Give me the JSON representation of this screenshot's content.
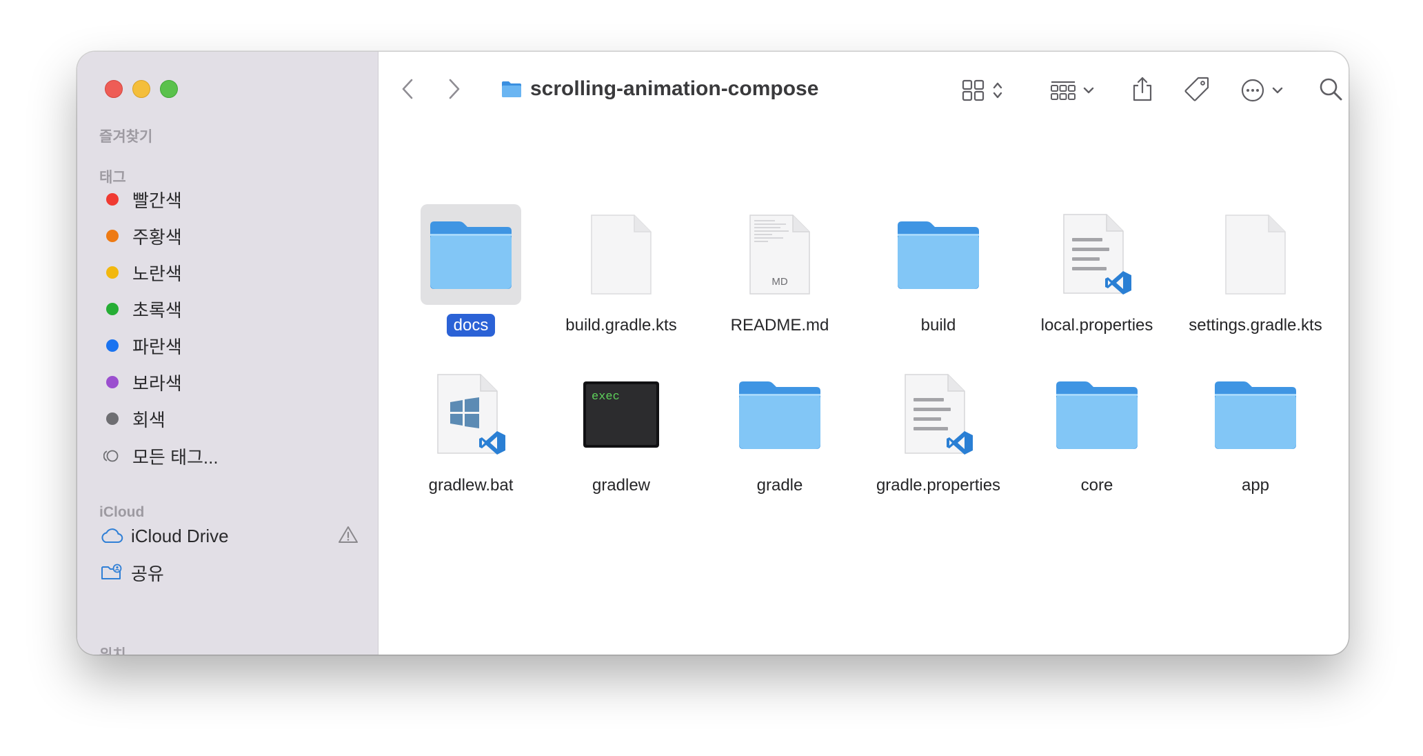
{
  "window": {
    "title": "scrolling-animation-compose"
  },
  "sidebar": {
    "favorites_label": "즐겨찾기",
    "tags_label": "태그",
    "tags": [
      {
        "label": "빨간색",
        "color": "#f03a32"
      },
      {
        "label": "주황색",
        "color": "#ee7a13"
      },
      {
        "label": "노란색",
        "color": "#f2b80f"
      },
      {
        "label": "초록색",
        "color": "#26ad35"
      },
      {
        "label": "파란색",
        "color": "#1a73f0"
      },
      {
        "label": "보라색",
        "color": "#9b4fcf"
      },
      {
        "label": "회색",
        "color": "#6e6e72"
      }
    ],
    "all_tags_label": "모든 태그...",
    "icloud_label": "iCloud",
    "icloud_items": [
      {
        "label": "iCloud Drive",
        "icon": "cloud-icon",
        "warning": true
      },
      {
        "label": "공유",
        "icon": "shared-folder-icon"
      }
    ],
    "locations_label": "위치"
  },
  "toolbar": {
    "back_icon": "chevron-left-icon",
    "forward_icon": "chevron-right-icon",
    "view_icon": "grid-view-icon",
    "group_icon": "group-by-icon",
    "share_icon": "share-icon",
    "tag_icon": "tag-icon",
    "more_icon": "ellipsis-circle-icon",
    "search_icon": "search-icon"
  },
  "files": [
    {
      "name": "docs",
      "type": "folder",
      "selected": true
    },
    {
      "name": "build.gradle.kts",
      "type": "blank"
    },
    {
      "name": "README.md",
      "type": "markdown",
      "badge": "MD"
    },
    {
      "name": "build",
      "type": "folder"
    },
    {
      "name": "local.properties",
      "type": "vscode-doc"
    },
    {
      "name": "settings.gradle.kts",
      "type": "blank"
    },
    {
      "name": "gradlew.bat",
      "type": "windows-bat"
    },
    {
      "name": "gradlew",
      "type": "exec",
      "badge": "exec"
    },
    {
      "name": "gradle",
      "type": "folder"
    },
    {
      "name": "gradle.properties",
      "type": "vscode-doc"
    },
    {
      "name": "core",
      "type": "folder"
    },
    {
      "name": "app",
      "type": "folder"
    }
  ],
  "colors": {
    "accent": "#2b62d6",
    "folder": "#7fc4f5",
    "sidebar": "#e2dfe6"
  }
}
